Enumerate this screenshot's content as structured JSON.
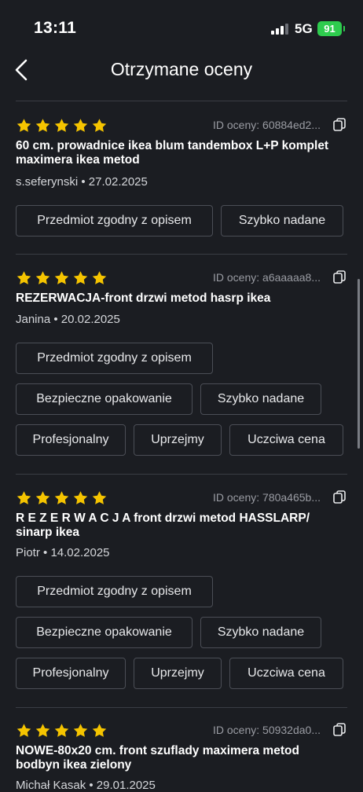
{
  "status": {
    "time": "13:11",
    "network": "5G",
    "battery": "91"
  },
  "header": {
    "title": "Otrzymane oceny"
  },
  "reviews": [
    {
      "id_text": "ID oceny: 60884ed2...",
      "title": "60 cm. prowadnice ikea blum tandembox  L+P komplet maximera ikea metod",
      "user": "s.seferynski",
      "date": "27.02.2025",
      "tags": [
        "Przedmiot zgodny z opisem",
        "Szybko nadane"
      ]
    },
    {
      "id_text": "ID oceny: a6aaaaa8...",
      "title": "REZERWACJA-front drzwi metod hasrp  ikea",
      "user": "Janina",
      "date": "20.02.2025",
      "tags": [
        "Przedmiot zgodny z opisem",
        "Bezpieczne opakowanie",
        "Szybko nadane",
        "Profesjonalny",
        "Uprzejmy",
        "Uczciwa cena"
      ]
    },
    {
      "id_text": "ID oceny: 780a465b...",
      "title": "R E Z E R W A C J A front drzwi metod HASSLARP/ sinarp ikea",
      "user": "Piotr",
      "date": "14.02.2025",
      "tags": [
        "Przedmiot zgodny z opisem",
        "Bezpieczne opakowanie",
        "Szybko nadane",
        "Profesjonalny",
        "Uprzejmy",
        "Uczciwa cena"
      ]
    },
    {
      "id_text": "ID oceny: 50932da0...",
      "title": "NOWE-80x20 cm. front szuflady maximera metod bodbyn ikea zielony",
      "user": "Michał Kasak",
      "date": "29.01.2025",
      "tags": []
    }
  ],
  "colors": {
    "background": "#1b1d22",
    "star": "#f5c400",
    "battery": "#2ecc4e"
  }
}
